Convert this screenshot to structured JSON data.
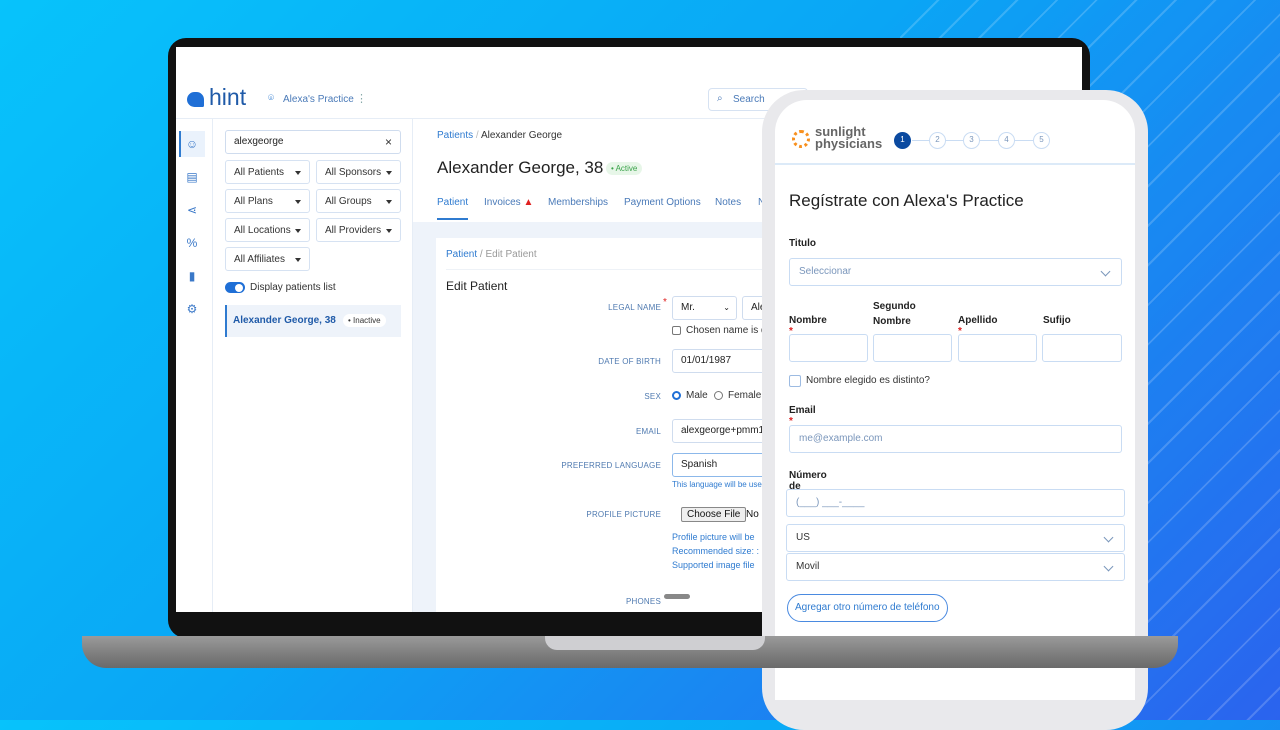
{
  "colors": {
    "accent": "#2f7bd0",
    "brand_dark": "#0b4aa0",
    "active_badge": "#3aa34a",
    "required": "#e02020",
    "sunlight_orange": "#f7901e"
  },
  "hint": {
    "logo": "hint",
    "practice": "Alexa's Practice",
    "search_label": "Search",
    "rail_icons": [
      "patients-icon",
      "billing-icon",
      "share-icon",
      "percent-icon",
      "chart-icon",
      "settings-icon"
    ],
    "sidebar": {
      "search_value": "alexgeorge",
      "filters": [
        "All Patients",
        "All Sponsors",
        "All Plans",
        "All Groups",
        "All Locations",
        "All Providers",
        "All Affiliates"
      ],
      "toggle_label": "Display patients list",
      "toggle_on": true,
      "patients": [
        {
          "name": "Alexander George, 38",
          "status": "Inactive"
        }
      ]
    },
    "main": {
      "breadcrumb_root": "Patients",
      "breadcrumb_current": "Alexander George",
      "title": "Alexander George, 38",
      "status": "Active",
      "tabs": [
        "Patient",
        "Invoices",
        "Memberships",
        "Payment Options",
        "Notes",
        "N"
      ],
      "card": {
        "breadcrumb_root": "Patient",
        "breadcrumb_current": "/ Edit Patient",
        "heading": "Edit Patient",
        "fields": {
          "legal_name_label": "LEGAL NAME",
          "prefix": "Mr.",
          "first_name": "Ale",
          "chosen_name": "Chosen name is d",
          "dob_label": "DATE OF BIRTH",
          "dob": "01/01/1987",
          "sex_label": "SEX",
          "sex_male": "Male",
          "sex_female": "Female",
          "email_label": "EMAIL",
          "email": "alexgeorge+pmm1",
          "language_label": "PREFERRED LANGUAGE",
          "language": "Spanish",
          "language_help": "This language will be use",
          "picture_label": "PROFILE PICTURE",
          "choose_file": "Choose File",
          "no_file": "No",
          "picture_help": [
            "Profile picture will be",
            "Recommended size: :",
            "Supported image file"
          ],
          "phones_label": "PHONES"
        }
      }
    }
  },
  "phone": {
    "logo_line1": "sunlight",
    "logo_line2": "physicians",
    "steps": [
      "1",
      "2",
      "3",
      "4",
      "5"
    ],
    "current_step": 1,
    "title": "Regístrate con Alexa's Practice",
    "titulo_label": "Titulo",
    "titulo_placeholder": "Seleccionar",
    "name_labels": [
      "Nombre",
      "Segundo Nombre",
      "Apellido",
      "Sufijo"
    ],
    "chosen_name": "Nombre elegido es distinto?",
    "email_label": "Email",
    "email_placeholder": "me@example.com",
    "phone_label": "Número de teléfono",
    "phone_placeholder": "(___) ___-____",
    "country": "US",
    "phone_type": "Movil",
    "add_phone": "Agregar otro número de teléfono"
  }
}
